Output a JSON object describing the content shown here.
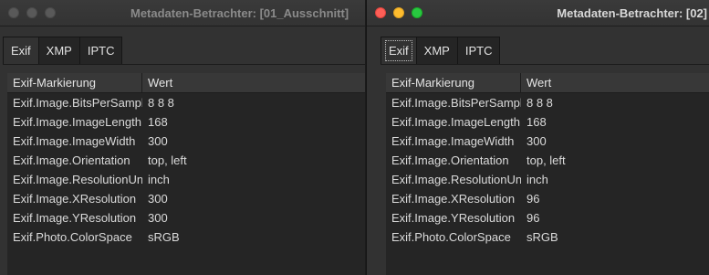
{
  "windows": [
    {
      "title": "Metadaten-Betrachter: [01_Ausschnitt]",
      "active": false,
      "tabs": [
        {
          "label": "Exif",
          "active": true
        },
        {
          "label": "XMP",
          "active": false
        },
        {
          "label": "IPTC",
          "active": false
        }
      ],
      "table": {
        "headers": [
          "Exif-Markierung",
          "Wert"
        ],
        "rows": [
          {
            "tag": "Exif.Image.BitsPerSample",
            "value": "8 8 8"
          },
          {
            "tag": "Exif.Image.ImageLength",
            "value": "168"
          },
          {
            "tag": "Exif.Image.ImageWidth",
            "value": "300"
          },
          {
            "tag": "Exif.Image.Orientation",
            "value": "top, left"
          },
          {
            "tag": "Exif.Image.ResolutionUnit",
            "value": "inch"
          },
          {
            "tag": "Exif.Image.XResolution",
            "value": "300"
          },
          {
            "tag": "Exif.Image.YResolution",
            "value": "300"
          },
          {
            "tag": "Exif.Photo.ColorSpace",
            "value": "sRGB"
          }
        ]
      }
    },
    {
      "title": "Metadaten-Betrachter: [02]",
      "active": true,
      "tabs": [
        {
          "label": "Exif",
          "active": true
        },
        {
          "label": "XMP",
          "active": false
        },
        {
          "label": "IPTC",
          "active": false
        }
      ],
      "table": {
        "headers": [
          "Exif-Markierung",
          "Wert"
        ],
        "rows": [
          {
            "tag": "Exif.Image.BitsPerSample",
            "value": "8 8 8"
          },
          {
            "tag": "Exif.Image.ImageLength",
            "value": "168"
          },
          {
            "tag": "Exif.Image.ImageWidth",
            "value": "300"
          },
          {
            "tag": "Exif.Image.Orientation",
            "value": "top, left"
          },
          {
            "tag": "Exif.Image.ResolutionUnit",
            "value": "inch"
          },
          {
            "tag": "Exif.Image.XResolution",
            "value": "96"
          },
          {
            "tag": "Exif.Image.YResolution",
            "value": "96"
          },
          {
            "tag": "Exif.Photo.ColorSpace",
            "value": "sRGB"
          }
        ]
      }
    }
  ],
  "colors": {
    "window_bg": "#323232",
    "table_bg": "#252525",
    "header_bg": "#383838",
    "close": "#fe5f57",
    "minimize": "#febc2e",
    "maximize": "#28c840",
    "inactive_light": "#595959"
  }
}
